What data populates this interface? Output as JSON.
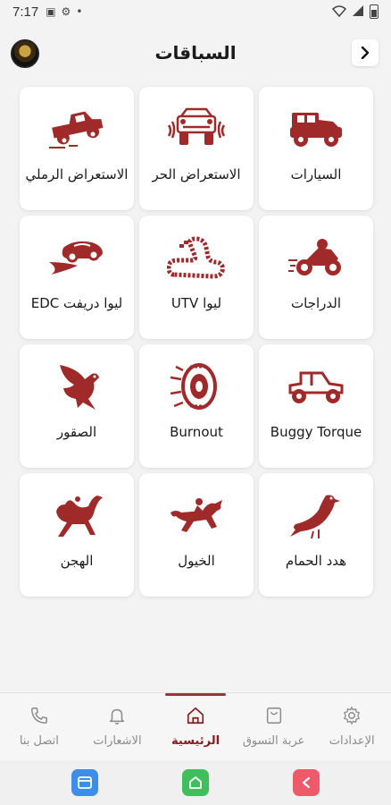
{
  "status_bar": {
    "time": "7:17"
  },
  "header": {
    "title": "السباقات"
  },
  "colors": {
    "accent": "#8b1a1a",
    "icon": "#a02a2a",
    "inactive": "#8a8a8a"
  },
  "categories": [
    {
      "label": "السيارات",
      "icon": "jeep-icon"
    },
    {
      "label": "الاستعراض الحر",
      "icon": "drift-car-icon"
    },
    {
      "label": "الاستعراض الرملي",
      "icon": "pickup-truck-icon"
    },
    {
      "label": "الدراجات",
      "icon": "motorbike-icon"
    },
    {
      "label": "ليوا UTV",
      "icon": "race-track-icon"
    },
    {
      "label": "ليوا دريفت EDC",
      "icon": "speed-car-icon"
    },
    {
      "label": "Buggy Torque",
      "icon": "buggy-icon"
    },
    {
      "label": "Burnout",
      "icon": "tire-icon"
    },
    {
      "label": "الصقور",
      "icon": "falcon-icon"
    },
    {
      "label": "هدد الحمام",
      "icon": "pigeon-icon"
    },
    {
      "label": "الخيول",
      "icon": "horse-icon"
    },
    {
      "label": "الهجن",
      "icon": "camel-icon"
    }
  ],
  "bottom_nav": [
    {
      "label": "الإعدادات",
      "icon": "gear-icon"
    },
    {
      "label": "عربة التسوق",
      "icon": "cart-icon"
    },
    {
      "label": "الرئيسية",
      "icon": "home-icon",
      "active": true
    },
    {
      "label": "الاشعارات",
      "icon": "bell-icon"
    },
    {
      "label": "اتصل بنا",
      "icon": "phone-icon"
    }
  ]
}
